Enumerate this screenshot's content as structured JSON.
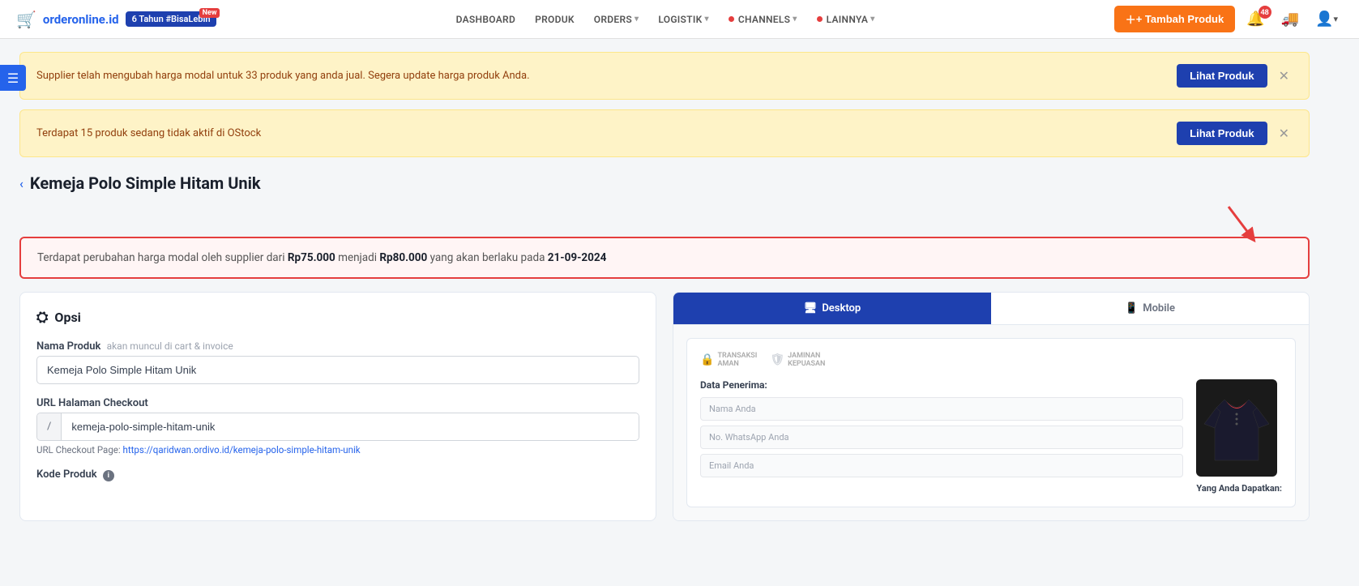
{
  "brand": {
    "logo_text": "orderonline.id",
    "promo_badge": "6 Tahun #BisaLebih",
    "badge_new": "New"
  },
  "navbar": {
    "dashboard": "DASHBOARD",
    "produk": "PRODUK",
    "orders": "ORDERS",
    "logistik": "LOGISTIK",
    "channels": "CHANNELS",
    "lainnya": "LAINNYA",
    "add_product": "+ Tambah Produk",
    "notif_count": "48"
  },
  "alerts": [
    {
      "text": "Supplier telah mengubah harga modal untuk 33 produk yang anda jual. Segera update harga produk Anda.",
      "button": "Lihat Produk"
    },
    {
      "text": "Terdapat 15 produk sedang tidak aktif di OStock",
      "button": "Lihat Produk"
    }
  ],
  "page": {
    "back_label": "‹",
    "title": "Kemeja Polo Simple Hitam Unik"
  },
  "warning": {
    "text_before": "Terdapat perubahan harga modal oleh supplier dari ",
    "old_price": "Rp75.000",
    "text_middle": " menjadi ",
    "new_price": "Rp80.000",
    "text_after": " yang akan berlaku pada ",
    "date": "21-09-2024"
  },
  "opsi_panel": {
    "title": "Opsi",
    "fields": {
      "nama_produk": {
        "label": "Nama Produk",
        "sublabel": "akan muncul di cart & invoice",
        "value": "Kemeja Polo Simple Hitam Unik",
        "placeholder": "Kemeja Polo Simple Hitam Unik"
      },
      "url_halaman": {
        "label": "URL Halaman Checkout",
        "prefix": "/",
        "value": "kemeja-polo-simple-hitam-unik",
        "placeholder": "kemeja-polo-simple-hitam-unik"
      },
      "checkout_url_hint": "URL Checkout Page: ",
      "checkout_url_link": "https://qaridwan.ordivo.id/kemeja-polo-simple-hitam-unik",
      "kode_produk": {
        "label": "Kode Produk"
      }
    }
  },
  "preview_panel": {
    "desktop_tab": "Desktop",
    "mobile_tab": "Mobile",
    "trust_badges": [
      "TRANSAKSI AMAN",
      "JAMINAN KEPUASAN"
    ],
    "data_penerima": "Data Penerima:",
    "inputs": [
      "Nama Anda",
      "No. WhatsApp Anda",
      "Email Anda"
    ],
    "yang_anda_dapatkan": "Yang Anda Dapatkan:"
  }
}
